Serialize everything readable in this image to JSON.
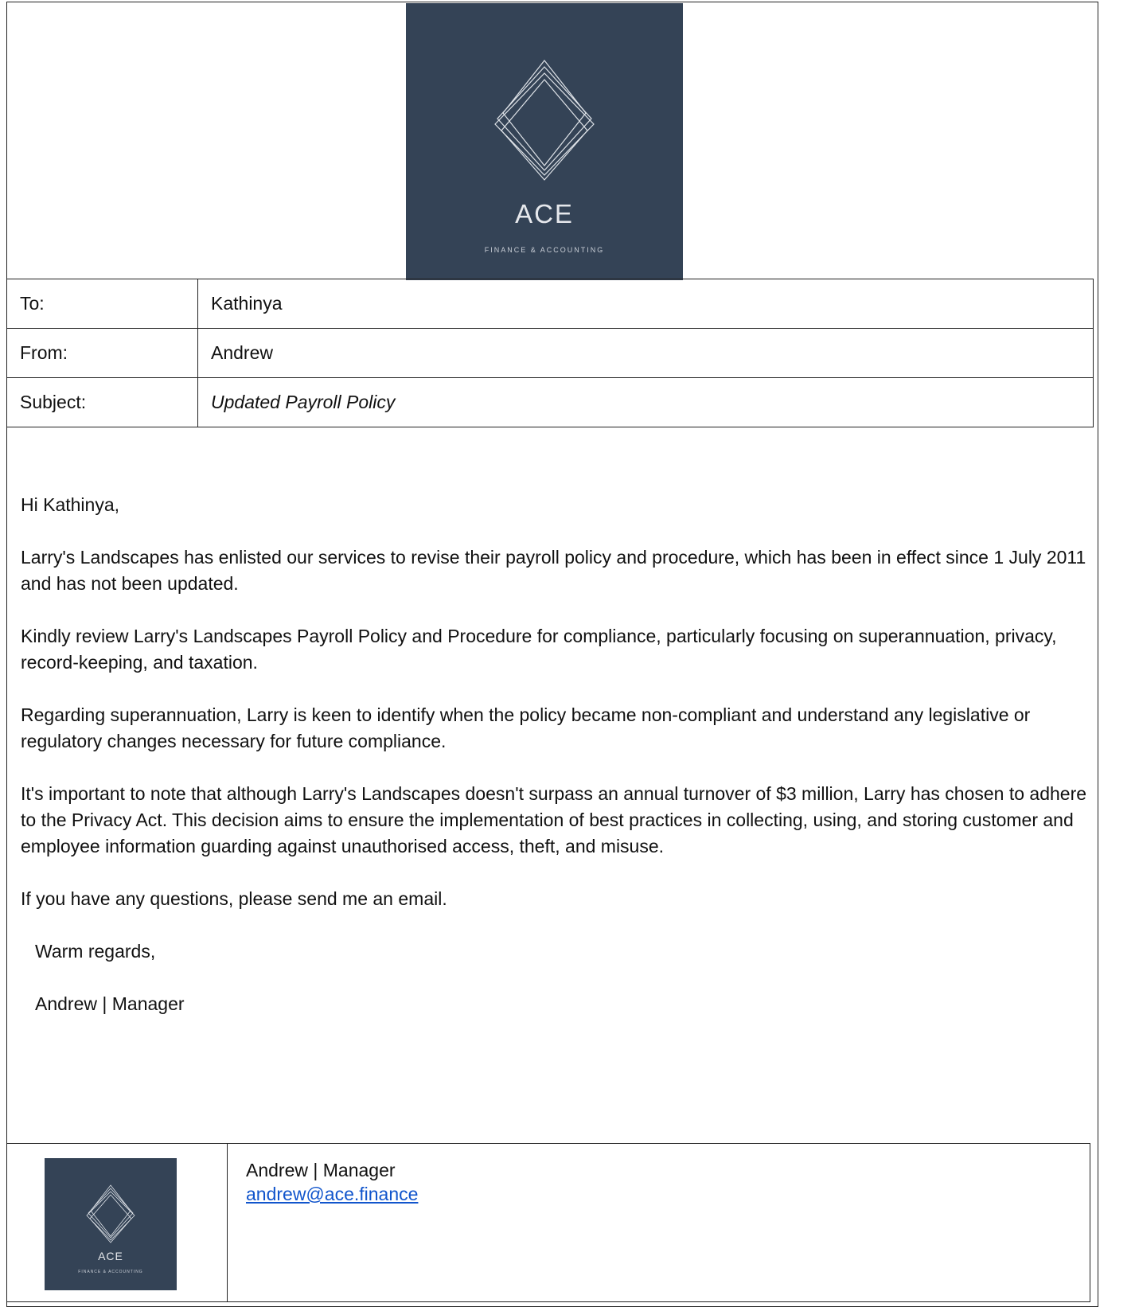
{
  "logo": {
    "wordmark": "ACE",
    "tagline": "FINANCE & ACCOUNTING",
    "background_color": "#344356"
  },
  "memo": {
    "to_label": "To:",
    "to_value": "Kathinya",
    "from_label": "From:",
    "from_value": "Andrew",
    "subject_label": "Subject:",
    "subject_value": "Updated Payroll Policy"
  },
  "body": {
    "greeting": "Hi Kathinya,",
    "paragraphs": [
      "Larry's Landscapes has enlisted our services to revise their payroll policy and procedure, which has been in effect since 1 July 2011 and has not been updated.",
      "Kindly review Larry's Landscapes Payroll Policy and Procedure for compliance, particularly focusing on superannuation, privacy, record-keeping, and taxation.",
      "Regarding superannuation, Larry is keen to identify when the policy became non-compliant and understand any legislative or regulatory changes necessary for future compliance.",
      "It's important to note that although Larry's Landscapes doesn't surpass an annual turnover of $3 million, Larry has chosen to adhere to the Privacy Act. This decision aims to ensure the implementation of best practices in collecting, using, and storing customer and employee information guarding against unauthorised access, theft, and misuse.",
      "If you have any questions, please send me an email."
    ],
    "closing": "Warm regards,",
    "sign_name": "Andrew | Manager"
  },
  "signature": {
    "name_title": "Andrew | Manager",
    "email": "andrew@ace.finance",
    "link_color": "#1155cc"
  }
}
